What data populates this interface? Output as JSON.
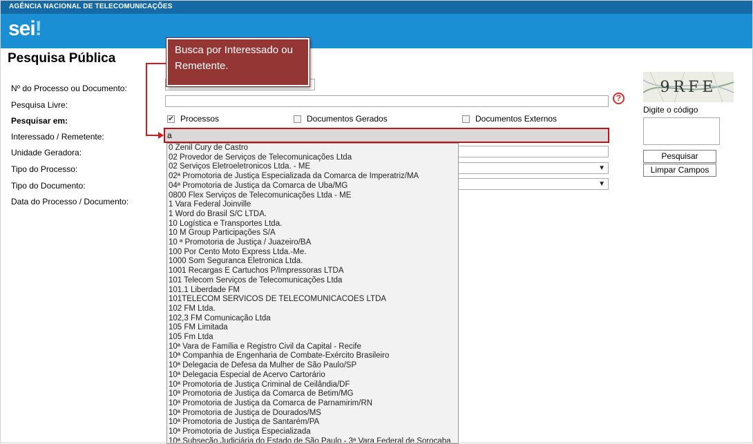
{
  "header": {
    "agency": "AGÊNCIA NACIONAL DE TELECOMUNICAÇÕES",
    "logo": "sei",
    "logo_mark": "!"
  },
  "page_title": "Pesquisa Pública",
  "form": {
    "labels": {
      "numero": "Nº do Processo ou Documento:",
      "livre": "Pesquisa Livre:",
      "pesquisar_em": "Pesquisar em:",
      "interessado": "Interessado / Remetente:",
      "unidade": "Unidade Geradora:",
      "tipo_processo": "Tipo do Processo:",
      "tipo_documento": "Tipo do Documento:",
      "data": "Data do Processo / Documento:"
    },
    "checkboxes": [
      {
        "label": "Processos",
        "checked": true,
        "mark": "✔"
      },
      {
        "label": "Documentos Gerados",
        "checked": false
      },
      {
        "label": "Documentos Externos",
        "checked": false
      }
    ],
    "interessado_value": "a",
    "help_icon": "?"
  },
  "autocomplete": [
    "0 Zenil Cury de Castro",
    "02 Provedor de Serviços de Telecomunicações Ltda",
    "02 Serviços Eletroeletronicos Ltda. - ME",
    "02ª Promotoria de Justiça Especializada da Comarca de Imperatriz/MA",
    "04ª Promotoria de Justiça da Comarca de Uba/MG",
    "0800 Flex Serviços de Telecomunicações Ltda - ME",
    "1 Vara Federal Joinville",
    "1 Word do Brasil S/C LTDA.",
    "10 Logística e Transportes Ltda.",
    "10 M Group Participações S/A",
    "10 ª Promotoria de Justiça / Juazeiro/BA",
    "100 Por Cento Moto Express Ltda.-Me.",
    "1000 Som Seguranca Eletronica Ltda.",
    "1001 Recargas E Cartuchos P/Impressoras LTDA",
    "101 Telecom Serviços de Telecomunicações Ltda",
    "101.1 Liberdade FM",
    "101TELECOM SERVICOS DE TELECOMUNICACOES LTDA",
    "102 FM Ltda.",
    "102,3 FM Comunicação Ltda",
    "105 FM Limitada",
    "105 Fm Ltda",
    "10ª Vara de Família e Registro Civil da Capital - Recife",
    "10ª Companhia de Engenharia de Combate-Exército Brasileiro",
    "10ª Delegacia de Defesa da Mulher de São Paulo/SP",
    "10ª Delegacia Especial de Acervo Cartorário",
    "10ª Promotoria de Justiça Criminal de Ceilândia/DF",
    "10ª Promotoria de Justiça da Comarca de Betim/MG",
    "10ª Promotoria de Justiça da Comarca de Parnamirim/RN",
    "10ª Promotoria de Justiça de Dourados/MS",
    "10ª Promotoria de Justiça de Santarém/PA",
    "10ª Promotoria de Justiça Especializada",
    "10ª Subseção Judiciária do Estado de São Paulo - 3ª Vara Federal de Sorocaba"
  ],
  "captcha": {
    "text": "9RFE",
    "label": "Digite o código"
  },
  "buttons": {
    "pesquisar": "Pesquisar",
    "limpar": "Limpar Campos"
  },
  "callout": {
    "text": "Busca por Interessado ou Remetente.",
    "color": "#943634",
    "line_color": "#d7191c"
  }
}
